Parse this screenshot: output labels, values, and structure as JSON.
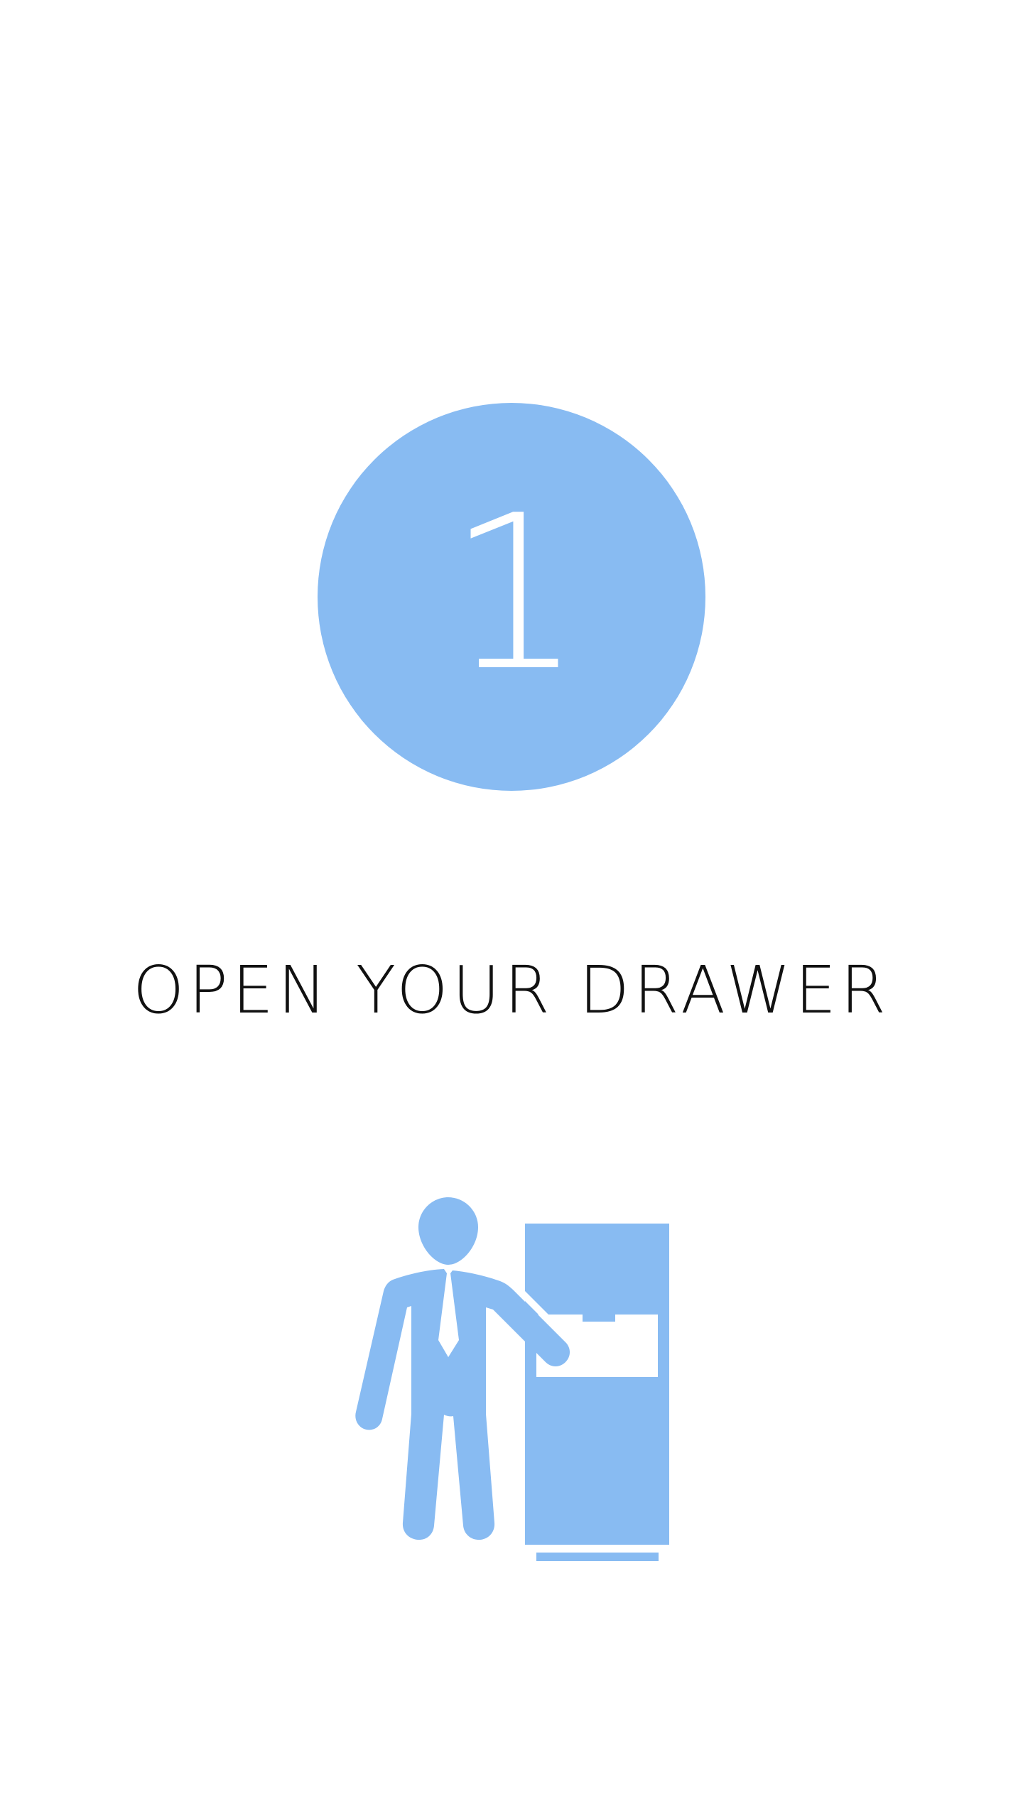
{
  "colors": {
    "accent": "#88BBF2",
    "background": "#FFFFFF",
    "text": "#111111"
  },
  "step": {
    "number": "1",
    "title": "OPEN YOUR DRAWER"
  },
  "illustration": {
    "icon": "person-at-filing-cabinet-icon"
  }
}
